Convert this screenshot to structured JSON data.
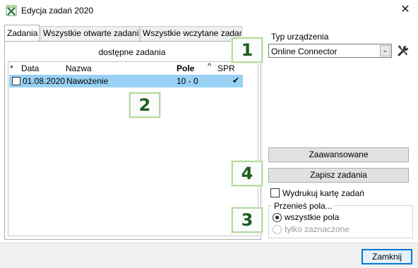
{
  "window": {
    "title": "Edycja zadań 2020",
    "close_glyph": "✕"
  },
  "tabs": [
    {
      "label": "Zadania",
      "active": true
    },
    {
      "label": "Wszystkie otwarte zadania",
      "active": false
    },
    {
      "label": "Wszystkie wczytane zadania",
      "active": false
    }
  ],
  "list": {
    "caption": "dostępne zadania",
    "columns": {
      "star": "*",
      "date": "Data",
      "name": "Nazwa",
      "field": "Pole",
      "sort_glyph": "^",
      "spr": "SPR"
    },
    "rows": [
      {
        "checked": false,
        "date": "01.08.2020",
        "name": "Nawożenie",
        "field": "10 - 0",
        "spr": "✔"
      }
    ]
  },
  "device": {
    "label": "Typ urządzenia",
    "selected": "Online Connector",
    "dropdown_glyph": "⌄"
  },
  "buttons": {
    "advanced": "Zaawansowane",
    "save": "Zapisz zadania",
    "close": "Zamknij"
  },
  "print_card": {
    "label": "Wydrukuj kartę zadań",
    "checked": false
  },
  "transfer": {
    "label": "Przenieś pola...",
    "options": [
      {
        "label": "wszystkie pola",
        "selected": true,
        "enabled": true
      },
      {
        "label": "tylko zaznaczone",
        "selected": false,
        "enabled": false
      }
    ]
  },
  "callouts": [
    "1",
    "2",
    "3",
    "4"
  ],
  "icons": {
    "app": "excel-app-icon",
    "tools": "tools-icon",
    "close": "close-icon",
    "dropdown": "chevron-down-icon",
    "check": "checkmark-icon"
  },
  "colors": {
    "selection": "#99d1f5",
    "callout_border": "#b7dba3",
    "callout_text": "#1b5e20",
    "default_button_border": "#0078d7"
  }
}
